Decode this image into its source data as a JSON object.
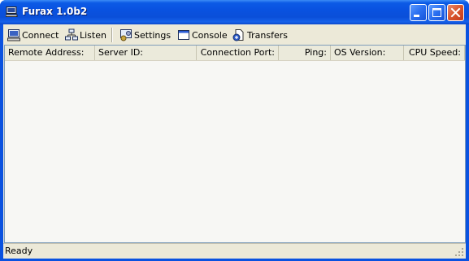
{
  "window": {
    "title": "Furax 1.0b2",
    "accent": "#0a52e0"
  },
  "toolbar": {
    "items": [
      {
        "label": "Connect",
        "icon": "computer-connect-icon"
      },
      {
        "label": "Listen",
        "icon": "network-listen-icon"
      },
      {
        "label": "Settings",
        "icon": "settings-icon"
      },
      {
        "label": "Console",
        "icon": "console-window-icon"
      },
      {
        "label": "Transfers",
        "icon": "transfers-icon"
      }
    ]
  },
  "table": {
    "columns": [
      "Remote Address:",
      "Server ID:",
      "Connection Port:",
      "Ping:",
      "OS Version:",
      "CPU Speed:"
    ],
    "rows": []
  },
  "status": {
    "text": "Ready"
  }
}
